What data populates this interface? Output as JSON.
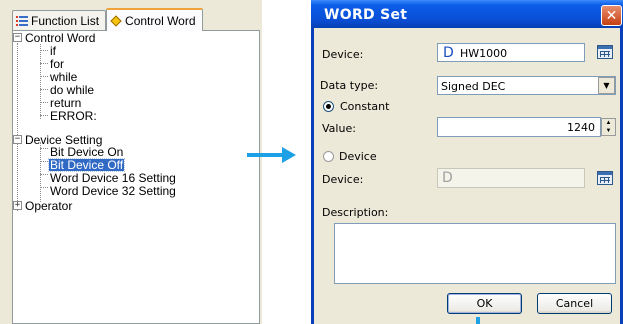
{
  "tabs": [
    {
      "label": "Function List",
      "icon": "function-list-icon"
    },
    {
      "label": "Control Word",
      "icon": "diamond-icon",
      "active": true
    }
  ],
  "tree": {
    "control_word": {
      "label": "Control Word",
      "expander": "−",
      "children": [
        "if",
        "for",
        "while",
        "do while",
        "return",
        "ERROR:"
      ]
    },
    "device_setting": {
      "label": "Device Setting",
      "expander": "−",
      "children": [
        "Bit Device On",
        "Bit Device Off",
        "Word Device 16 Setting",
        "Word Device 32 Setting"
      ],
      "selected": "Bit Device Off"
    },
    "operator": {
      "label": "Operator",
      "expander": "+"
    }
  },
  "dialog": {
    "title": "WORD Set",
    "close_glyph": "✕",
    "device_label": "Device:",
    "device_prefix": "D",
    "device_value": "HW1000",
    "data_type_label": "Data type:",
    "data_type_value": "Signed DEC",
    "constant_label": "Constant",
    "value_label": "Value:",
    "value": "1240",
    "device_radio_label": "Device",
    "device2_label": "Device:",
    "device2_prefix": "D",
    "description_label": "Description:",
    "ok_label": "OK",
    "cancel_label": "Cancel"
  },
  "colors": {
    "accent_arrow": "#1ea0e6",
    "title_bar": "#0a4fd6",
    "selection": "#316ac5"
  }
}
